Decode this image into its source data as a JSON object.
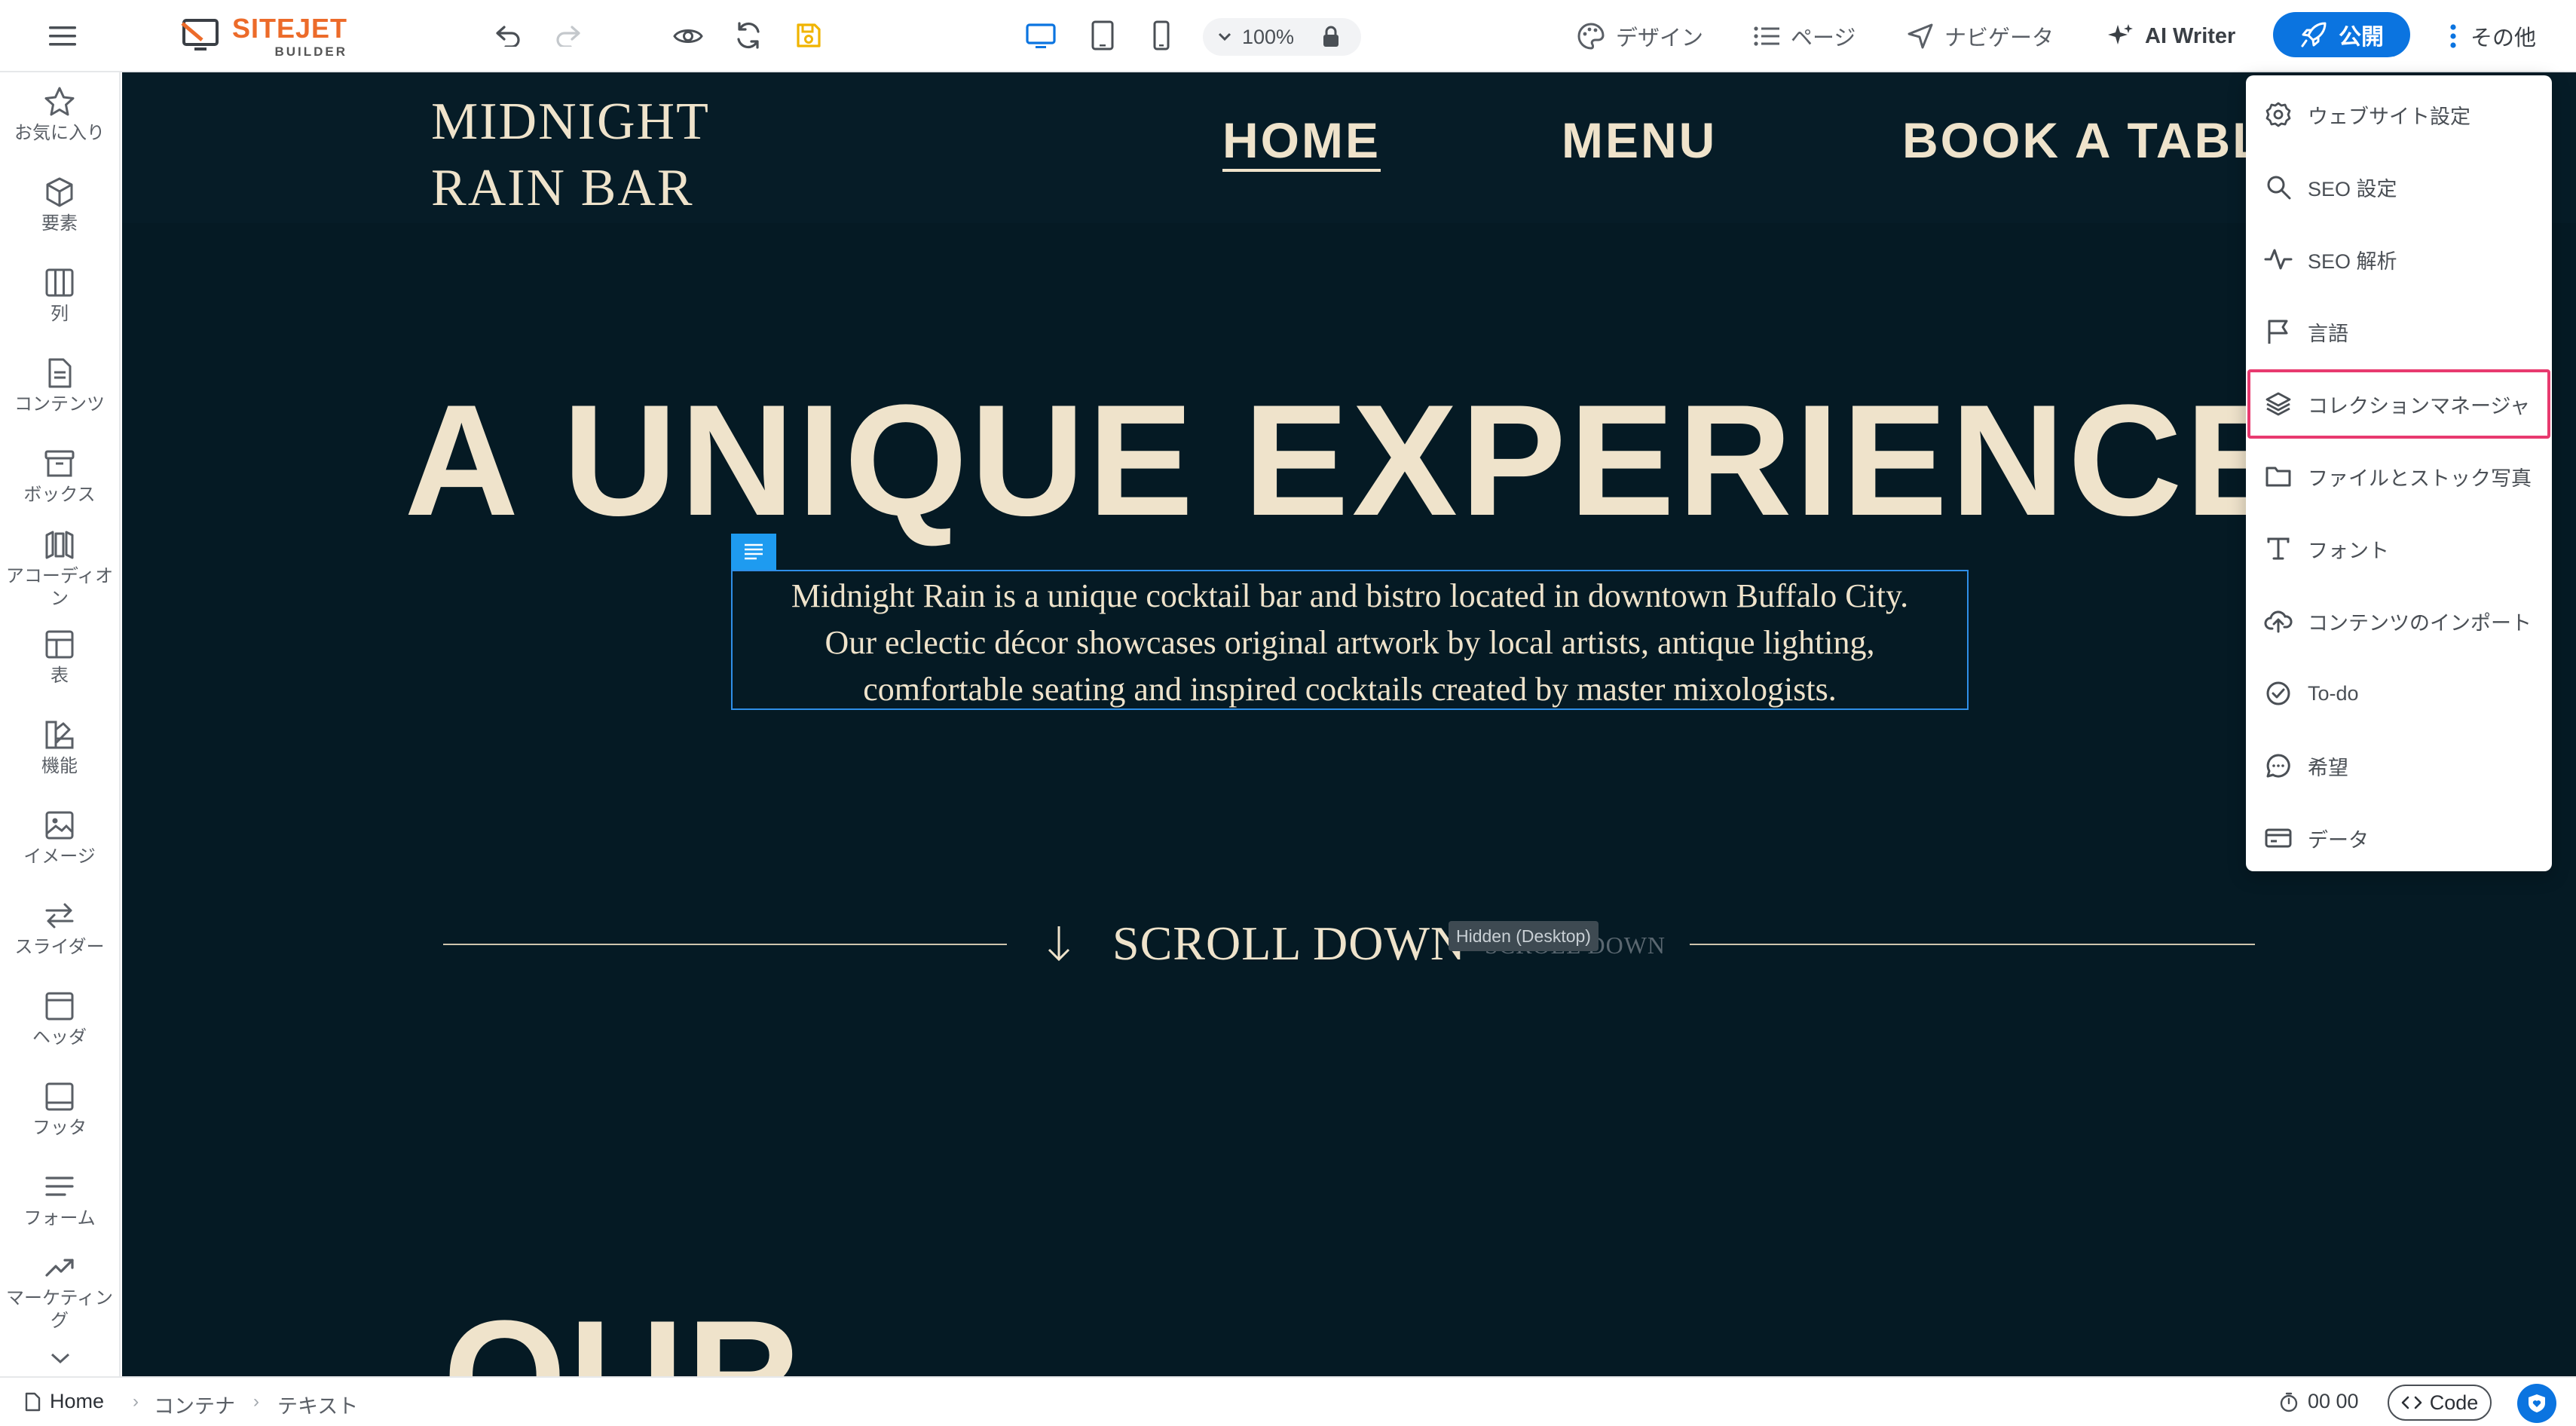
{
  "app": {
    "logo_main": "SITEJET",
    "logo_sub": "BUILDER",
    "zoom": "100%",
    "nav": {
      "design": "デザイン",
      "pages": "ページ",
      "navigator": "ナビゲータ",
      "ai_writer": "AI Writer"
    },
    "publish_label": "公開",
    "more_label": "その他",
    "accent_color": "#0b74e0",
    "logo_color": "#ec6b2a"
  },
  "sidebar": {
    "items": [
      {
        "label": "お気に入り",
        "icon": "star-icon"
      },
      {
        "label": "要素",
        "icon": "cube-icon"
      },
      {
        "label": "列",
        "icon": "columns-icon"
      },
      {
        "label": "コンテンツ",
        "icon": "document-icon"
      },
      {
        "label": "ボックス",
        "icon": "box-icon"
      },
      {
        "label": "アコーディオン",
        "icon": "accordion-icon"
      },
      {
        "label": "表",
        "icon": "table-icon"
      },
      {
        "label": "機能",
        "icon": "shapes-icon"
      },
      {
        "label": "イメージ",
        "icon": "image-icon"
      },
      {
        "label": "スライダー",
        "icon": "arrows-icon"
      },
      {
        "label": "ヘッダ",
        "icon": "header-icon"
      },
      {
        "label": "フッタ",
        "icon": "footer-icon"
      },
      {
        "label": "フォーム",
        "icon": "form-icon"
      },
      {
        "label": "マーケティング",
        "icon": "trending-icon"
      }
    ]
  },
  "site": {
    "brand_line1": "MIDNIGHT",
    "brand_line2": "RAIN BAR",
    "nav": [
      "HOME",
      "MENU",
      "BOOK A TABLE"
    ],
    "hero_title": "A UNIQUE EXPERIENCE",
    "hero_text_lines": [
      "Midnight Rain is a unique cocktail bar and bistro located in downtown Buffalo City.",
      "Our eclectic décor showcases original artwork by local artists, antique lighting,",
      "comfortable seating and inspired cocktails created by master mixologists."
    ],
    "scroll_label": "SCROLL DOWN",
    "scroll_ghost": "SCROLL DOWN",
    "hidden_badge": "Hidden (Desktop)",
    "section_title": "OUR",
    "text_color": "#efe3cb",
    "background_color": "#051a24"
  },
  "dropdown": {
    "items": [
      {
        "label": "ウェブサイト設定",
        "icon": "gear-icon"
      },
      {
        "label": "SEO 設定",
        "icon": "search-icon"
      },
      {
        "label": "SEO 解析",
        "icon": "pulse-icon"
      },
      {
        "label": "言語",
        "icon": "flag-icon"
      },
      {
        "label": "コレクションマネージャ",
        "icon": "layers-icon",
        "highlighted": true
      },
      {
        "label": "ファイルとストック写真",
        "icon": "folder-icon"
      },
      {
        "label": "フォント",
        "icon": "type-icon"
      },
      {
        "label": "コンテンツのインポート",
        "icon": "cloud-upload-icon"
      },
      {
        "label": "To-do",
        "icon": "check-circle-icon"
      },
      {
        "label": "希望",
        "icon": "chat-icon"
      },
      {
        "label": "データ",
        "icon": "card-icon"
      }
    ],
    "highlight_color": "#e83a6f"
  },
  "bottombar": {
    "breadcrumb": [
      "Home",
      "コンテナ",
      "テキスト"
    ],
    "timer": "00 00",
    "code_label": "Code"
  }
}
